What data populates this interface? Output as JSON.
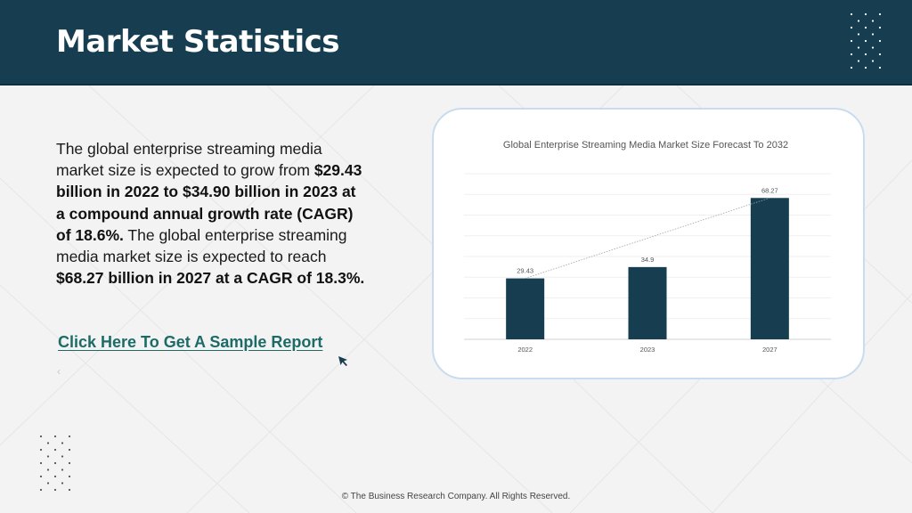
{
  "page": {
    "title": "Market Statistics",
    "body_parts": [
      {
        "text": "The global enterprise streaming media market size is expected to grow from ",
        "bold": false
      },
      {
        "text": "$29.43 billion in 2022 to $34.90 billion in 2023 at a compound annual growth rate (CAGR) of 18.6%.",
        "bold": true
      },
      {
        "text": " The global enterprise streaming media market size is expected to reach ",
        "bold": false
      },
      {
        "text": "$68.27 billion in 2027 at a CAGR of 18.3%.",
        "bold": true
      }
    ],
    "cta_label": "Click Here To Get A Sample Report",
    "footer": "© The Business Research Company. All Rights Reserved."
  },
  "chart_data": {
    "type": "bar",
    "title": "Global Enterprise Streaming Media Market Size Forecast To 2032",
    "categories": [
      "2022",
      "2023",
      "2027"
    ],
    "values": [
      29.43,
      34.9,
      68.27
    ],
    "value_labels": [
      "29.43",
      "34.9",
      "68.27"
    ],
    "ylim": [
      0,
      80
    ],
    "grid": true,
    "trendline": true,
    "bar_color": "#163d50"
  },
  "colors": {
    "header_bg": "#163d50",
    "link": "#1d6b67",
    "card_border": "#c9dcef"
  },
  "icons": [
    "cursor-arrow-icon",
    "dot-pattern-icon"
  ]
}
